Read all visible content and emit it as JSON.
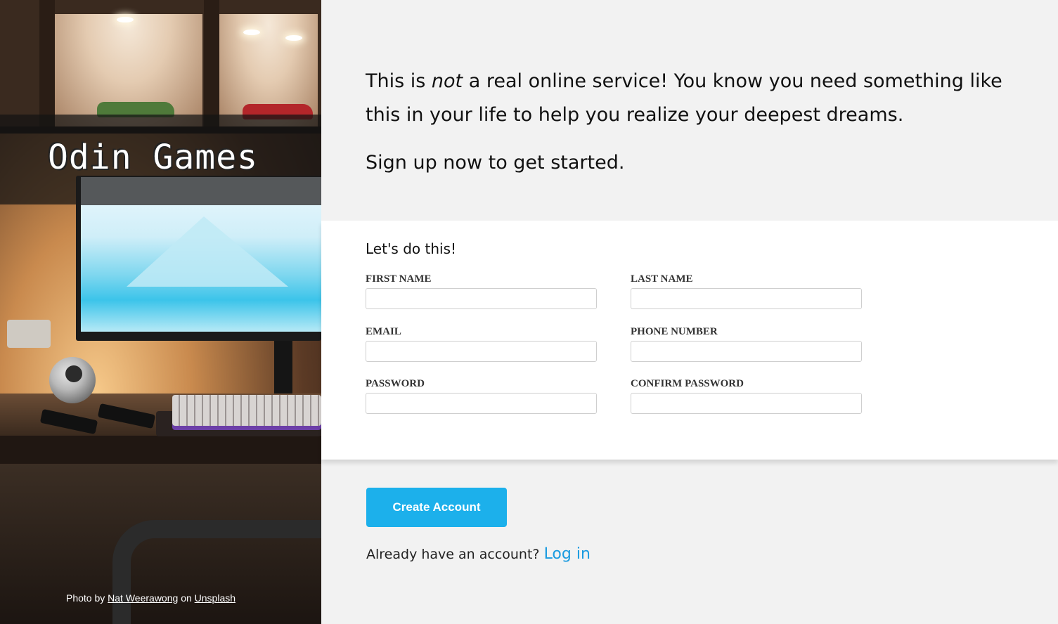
{
  "brand": {
    "name": "Odin Games"
  },
  "credit": {
    "prefix": "Photo by",
    "author": "Nat Weerawong",
    "middle": "on",
    "site": "Unsplash"
  },
  "intro": {
    "line1_before": "This is ",
    "line1_emph": "not",
    "line1_after": " a real online service! You know you need something like this in your life to help you realize your deepest dreams.",
    "line2": "Sign up now to get started."
  },
  "form": {
    "title": "Let's do this!",
    "fields": {
      "first_name": {
        "label": "FIRST NAME",
        "value": ""
      },
      "last_name": {
        "label": "LAST NAME",
        "value": ""
      },
      "email": {
        "label": "EMAIL",
        "value": ""
      },
      "phone": {
        "label": "PHONE NUMBER",
        "value": ""
      },
      "password": {
        "label": "PASSWORD",
        "value": ""
      },
      "confirm_password": {
        "label": "CONFIRM PASSWORD",
        "value": ""
      }
    }
  },
  "actions": {
    "create_label": "Create Account"
  },
  "login": {
    "prompt": "Already have an account?",
    "link": "Log in"
  },
  "colors": {
    "accent": "#1cb0eb",
    "link": "#1a9be0",
    "background": "#f2f2f2",
    "card": "#ffffff"
  }
}
